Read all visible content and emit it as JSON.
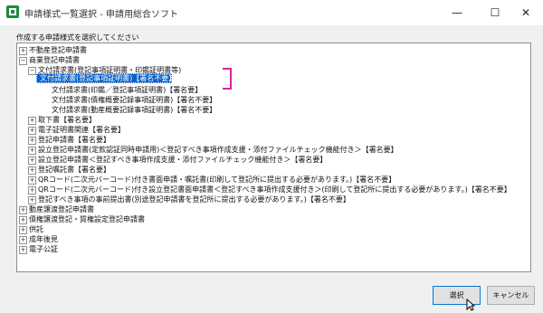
{
  "window": {
    "title": "申請様式一覧選択 - 申請用総合ソフト",
    "minimize": "—",
    "maximize": "☐",
    "close": "✕"
  },
  "instruction": "作成する申請様式を選択してください",
  "tree": {
    "items": [
      {
        "label": "不動産登記申請書",
        "expander": "+"
      },
      {
        "label": "商業登記申請書",
        "expander": "−"
      },
      {
        "label": "文付請求書(登記事項証明書・印鑑証明書等)",
        "expander": "−"
      },
      {
        "label": "文付請求書(登記事項証明書)【署名不要】",
        "selected": true
      },
      {
        "label": "文付請求書(印鑑／登記事項証明書)【署名要】"
      },
      {
        "label": "文付請求書(債権概要記録事項証明書)【署名不要】"
      },
      {
        "label": "文付請求書(動産概要記録事項証明書)【署名不要】"
      },
      {
        "label": "取下書【署名要】",
        "expander": "+"
      },
      {
        "label": "電子証明書関連【署名要】",
        "expander": "+"
      },
      {
        "label": "登記申請書【署名要】",
        "expander": "+"
      },
      {
        "label": "設立登記申請書(定款認証同時申請用)＜登記すべき事項作成支援・添付ファイルチェック機能付き＞【署名要】",
        "expander": "+"
      },
      {
        "label": "設立登記申請書＜登記すべき事項作成支援・添付ファイルチェック機能付き＞【署名要】",
        "expander": "+"
      },
      {
        "label": "登記嘱託書【署名要】",
        "expander": "+"
      },
      {
        "label": "QRコード(二次元バーコード)付き書面申請・嘱託書(印刷して登記所に提出する必要があります。)【署名不要】",
        "expander": "+"
      },
      {
        "label": "QRコード(二次元バーコード)付き設立登記書面申請書＜登記すべき事項作成支援付き＞(印刷して登記所に提出する必要があります。)【署名不要】",
        "expander": "+"
      },
      {
        "label": "登記すべき事項の事前提出書(別途登記申請書を登記所に提出する必要があります。)【署名不要】",
        "expander": "+"
      },
      {
        "label": "動産譲渡登記申請書",
        "expander": "+"
      },
      {
        "label": "債権譲渡登記・質権設定登記申請書",
        "expander": "+"
      },
      {
        "label": "供託",
        "expander": "+"
      },
      {
        "label": "成年後見",
        "expander": "+"
      },
      {
        "label": "電子公証",
        "expander": "+"
      }
    ]
  },
  "buttons": {
    "select": "選択",
    "cancel": "キャンセル"
  },
  "colors": {
    "selection": "#0a62c9",
    "annotation": "#e0219b",
    "app_icon": "#1e8a3c"
  }
}
